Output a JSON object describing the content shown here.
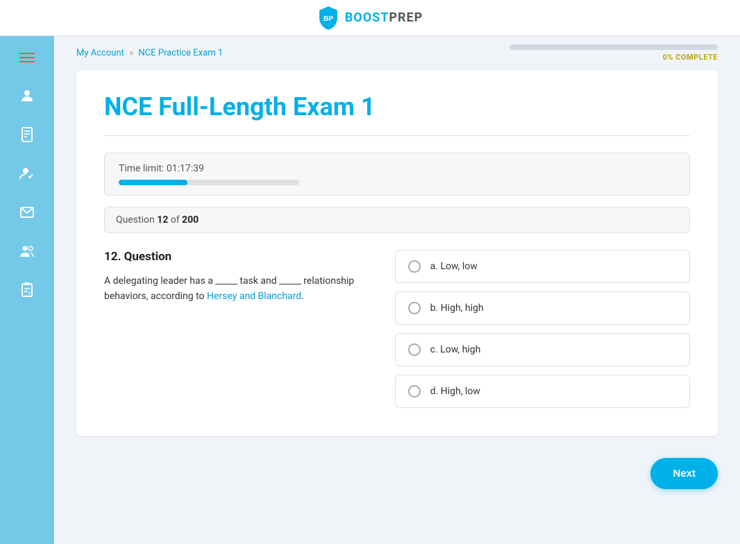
{
  "header": {
    "logo_brand": "BOOST",
    "logo_suffix": "PREP"
  },
  "breadcrumb": {
    "account": "My Account",
    "separator": "»",
    "exam": "NCE Practice Exam 1"
  },
  "progress": {
    "percent": 0,
    "label": "0% COMPLETE",
    "bar_width": "0%"
  },
  "exam": {
    "title": "NCE Full-Length Exam 1"
  },
  "timer": {
    "label": "Time limit: 01:17:39"
  },
  "question_counter": {
    "prefix": "Question ",
    "current": "12",
    "middle": " of ",
    "total": "200"
  },
  "question": {
    "number_label": "12. Question",
    "text_part1": "A delegating leader has a _____ task and _____",
    "text_part2": " relationship behaviors, according to ",
    "text_link": "Hersey and Blanchard",
    "text_end": "."
  },
  "options": [
    {
      "id": "a",
      "label": "a. Low, low",
      "highlight_start": 3,
      "highlight_text": ""
    },
    {
      "id": "b",
      "label": "b. High, high",
      "highlight_text": ""
    },
    {
      "id": "c",
      "label": "c. Low, high",
      "highlight_text": ""
    },
    {
      "id": "d",
      "label": "d. High, low",
      "highlight_text": ""
    }
  ],
  "option_labels": {
    "a": "a. Low, low",
    "b": "b. High, high",
    "c": "c. Low, high",
    "d": "d. High, low"
  },
  "buttons": {
    "next": "Next"
  },
  "sidebar_icons": [
    "user-icon",
    "document-icon",
    "user-check-icon",
    "envelope-icon",
    "users-icon",
    "report-icon"
  ]
}
